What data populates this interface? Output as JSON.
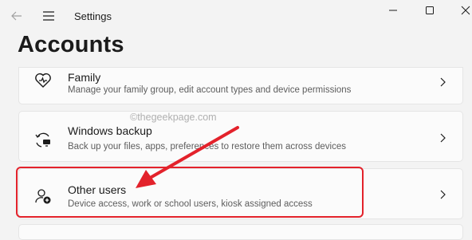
{
  "window": {
    "title": "Settings",
    "icons": {
      "back": "back-arrow-icon",
      "menu": "hamburger-menu-icon",
      "minimize": "minimize-icon",
      "maximize": "maximize-icon",
      "close": "close-icon"
    }
  },
  "page": {
    "title": "Accounts"
  },
  "watermark": "©thegeekpage.com",
  "cards": {
    "family": {
      "title": "Family",
      "description": "Manage your family group, edit account types and device permissions",
      "icon": "family-heart-icon"
    },
    "backup": {
      "title": "Windows backup",
      "description": "Back up your files, apps, preferences to restore them across devices",
      "icon": "backup-icon"
    },
    "other_users": {
      "title": "Other users",
      "description": "Device access, work or school users, kiosk assigned access",
      "icon": "add-user-icon"
    }
  },
  "colors": {
    "background": "#f3f3f3",
    "card": "#fbfbfb",
    "annotation": "#e3222b"
  }
}
